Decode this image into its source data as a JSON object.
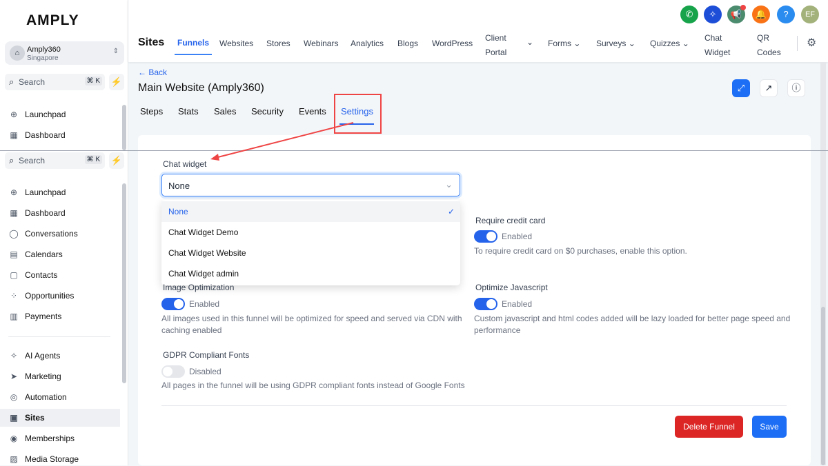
{
  "brand": {
    "logo": "AMPLY"
  },
  "account": {
    "name": "Amply360",
    "location": "Singapore"
  },
  "search": {
    "label": "Search",
    "shortcut": "⌘ K"
  },
  "sidebar_top": [
    {
      "label": "Launchpad",
      "icon": "rocket-icon"
    },
    {
      "label": "Dashboard",
      "icon": "grid-icon"
    }
  ],
  "sidebar": [
    {
      "label": "Launchpad"
    },
    {
      "label": "Dashboard"
    },
    {
      "label": "Conversations"
    },
    {
      "label": "Calendars"
    },
    {
      "label": "Contacts"
    },
    {
      "label": "Opportunities"
    },
    {
      "label": "Payments"
    },
    {
      "label": "AI Agents"
    },
    {
      "label": "Marketing"
    },
    {
      "label": "Automation"
    },
    {
      "label": "Sites"
    },
    {
      "label": "Memberships"
    },
    {
      "label": "Media Storage"
    }
  ],
  "topnav": {
    "title": "Sites",
    "tabs": [
      "Funnels",
      "Websites",
      "Stores",
      "Webinars",
      "Analytics",
      "Blogs",
      "WordPress"
    ],
    "client_portal": [
      "Client",
      "Portal"
    ],
    "dropdowns": [
      "Forms",
      "Surveys",
      "Quizzes"
    ],
    "chat_widget": [
      "Chat",
      "Widget"
    ],
    "qr_codes": [
      "QR",
      "Codes"
    ]
  },
  "header_icons": {
    "help": "?",
    "avatar": "EF"
  },
  "page": {
    "back": "← Back",
    "title": "Main Website (Amply360)",
    "tabs": [
      "Steps",
      "Stats",
      "Sales",
      "Security",
      "Events",
      "Settings"
    ],
    "active_tab": "Settings"
  },
  "chat_widget": {
    "label": "Chat widget",
    "value": "None",
    "options": [
      "None",
      "Chat Widget Demo",
      "Chat Widget Website",
      "Chat Widget admin"
    ]
  },
  "settings": {
    "credit": {
      "title": "Require credit card",
      "state": "Enabled",
      "desc": "To require credit card on $0 purchases, enable this option."
    },
    "image": {
      "title": "Image Optimization",
      "state": "Enabled",
      "desc": "All images used in this funnel will be optimized for speed and served via CDN with caching enabled"
    },
    "js": {
      "title": "Optimize Javascript",
      "state": "Enabled",
      "desc": "Custom javascript and html codes added will be lazy loaded for better page speed and performance"
    },
    "gdpr": {
      "title": "GDPR Compliant Fonts",
      "state": "Disabled",
      "desc": "All pages in the funnel will be using GDPR compliant fonts instead of Google Fonts"
    }
  },
  "actions": {
    "delete": "Delete Funnel",
    "save": "Save"
  },
  "colors": {
    "primary": "#2563eb",
    "danger": "#dc2626",
    "annotation": "#ef4444"
  }
}
